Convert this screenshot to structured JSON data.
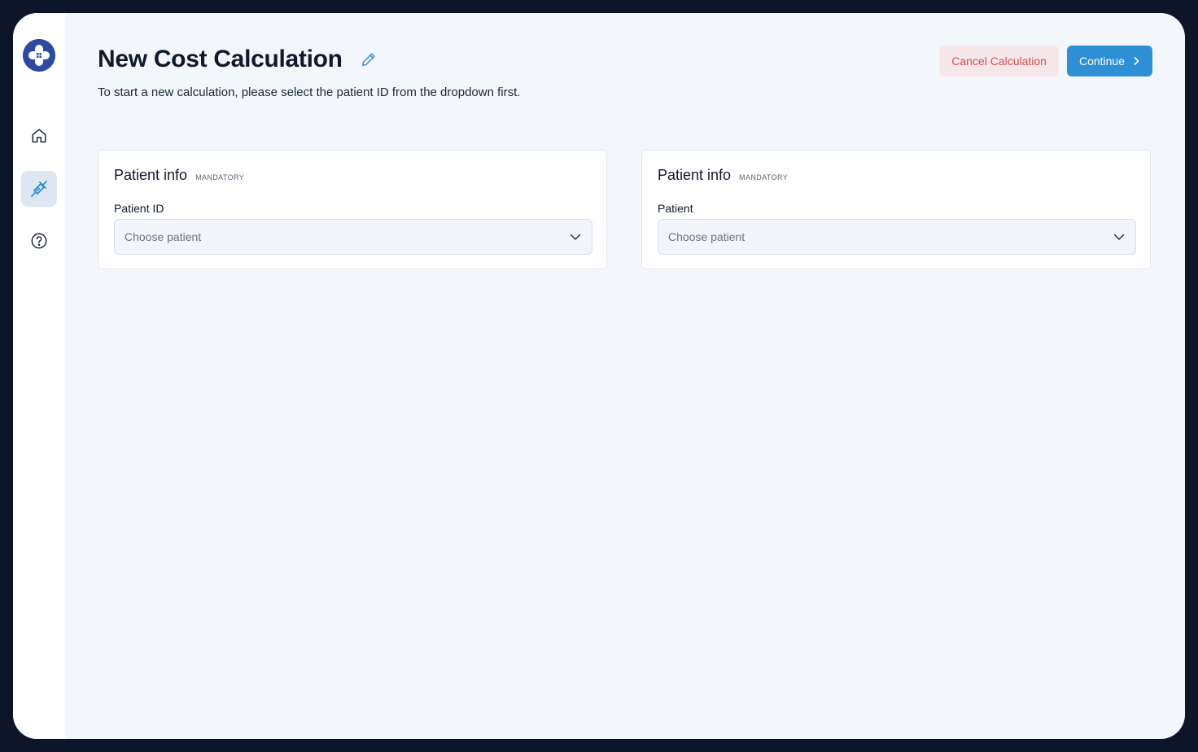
{
  "header": {
    "title": "New Cost Calculation",
    "subtitle": "To start a new calculation, please select the patient ID from the dropdown first."
  },
  "actions": {
    "cancel_label": "Cancel Calculation",
    "continue_label": "Continue"
  },
  "sidebar": {
    "items": [
      {
        "icon": "home-icon"
      },
      {
        "icon": "syringe-icon",
        "active": true
      },
      {
        "icon": "help-icon"
      }
    ]
  },
  "cards": [
    {
      "title": "Patient info",
      "badge": "MANDATORY",
      "field_label": "Patient ID",
      "placeholder": "Choose patient"
    },
    {
      "title": "Patient info",
      "badge": "MANDATORY",
      "field_label": "Patient",
      "placeholder": "Choose patient"
    }
  ],
  "colors": {
    "accent": "#2e8fd5",
    "cancel_text": "#dc4a50",
    "cancel_bg": "#f6e8ea",
    "logo": "#2c4aa0",
    "frame": "#0c1628",
    "background": "#f3f7fc"
  }
}
